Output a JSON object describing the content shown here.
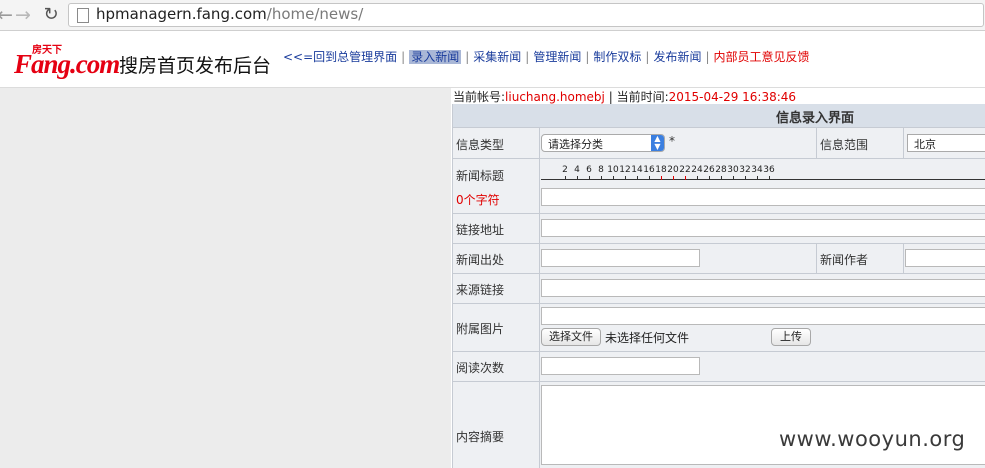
{
  "browser": {
    "url_host": "hpmanagern.fang.com",
    "url_path": "/home/news/"
  },
  "header": {
    "logo_small": "房天下",
    "logo_main": "Fang.com",
    "site_title": "搜房首页发布后台",
    "nav": [
      {
        "label": "<<=回到总管理界面"
      },
      {
        "label": "录入新闻",
        "active": true
      },
      {
        "label": "采集新闻"
      },
      {
        "label": "管理新闻"
      },
      {
        "label": "制作双标"
      },
      {
        "label": "发布新闻"
      },
      {
        "label": "内部员工意见反馈",
        "color": "#e00000"
      }
    ]
  },
  "account": {
    "label": "当前帐号:",
    "username": "liuchang.homebj",
    "sep": " | ",
    "time_label": "当前时间:",
    "time": "2015-04-29 16:38:46"
  },
  "form": {
    "title": "信息录入界面",
    "info_type": {
      "label": "信息类型",
      "value": "请选择分类",
      "required": "*"
    },
    "info_scope": {
      "label": "信息范围",
      "value": "北京"
    },
    "news_title": {
      "label": "新闻标题",
      "char_count": "0个字符"
    },
    "ruler": {
      "numbers": [
        "2",
        "4",
        "6",
        "8",
        "10",
        "12",
        "14",
        "16",
        "18",
        "20",
        "22",
        "24",
        "26",
        "28",
        "30",
        "32",
        "34",
        "36"
      ],
      "red_at": [
        "18",
        "20",
        "22"
      ]
    },
    "link_url": {
      "label": "链接地址"
    },
    "news_source": {
      "label": "新闻出处"
    },
    "news_author": {
      "label": "新闻作者"
    },
    "source_link": {
      "label": "来源链接"
    },
    "attached_image": {
      "label": "附属图片",
      "choose_file": "选择文件",
      "no_file": "未选择任何文件",
      "upload": "上传"
    },
    "read_count": {
      "label": "阅读次数"
    },
    "summary": {
      "label": "内容摘要"
    }
  },
  "watermark": "www.wooyun.org",
  "colors": {
    "accent_red": "#e50012",
    "link_blue": "#1a3c9c",
    "active_bg": "#a9b7d6",
    "select_arrow": "#3b7fe0"
  }
}
